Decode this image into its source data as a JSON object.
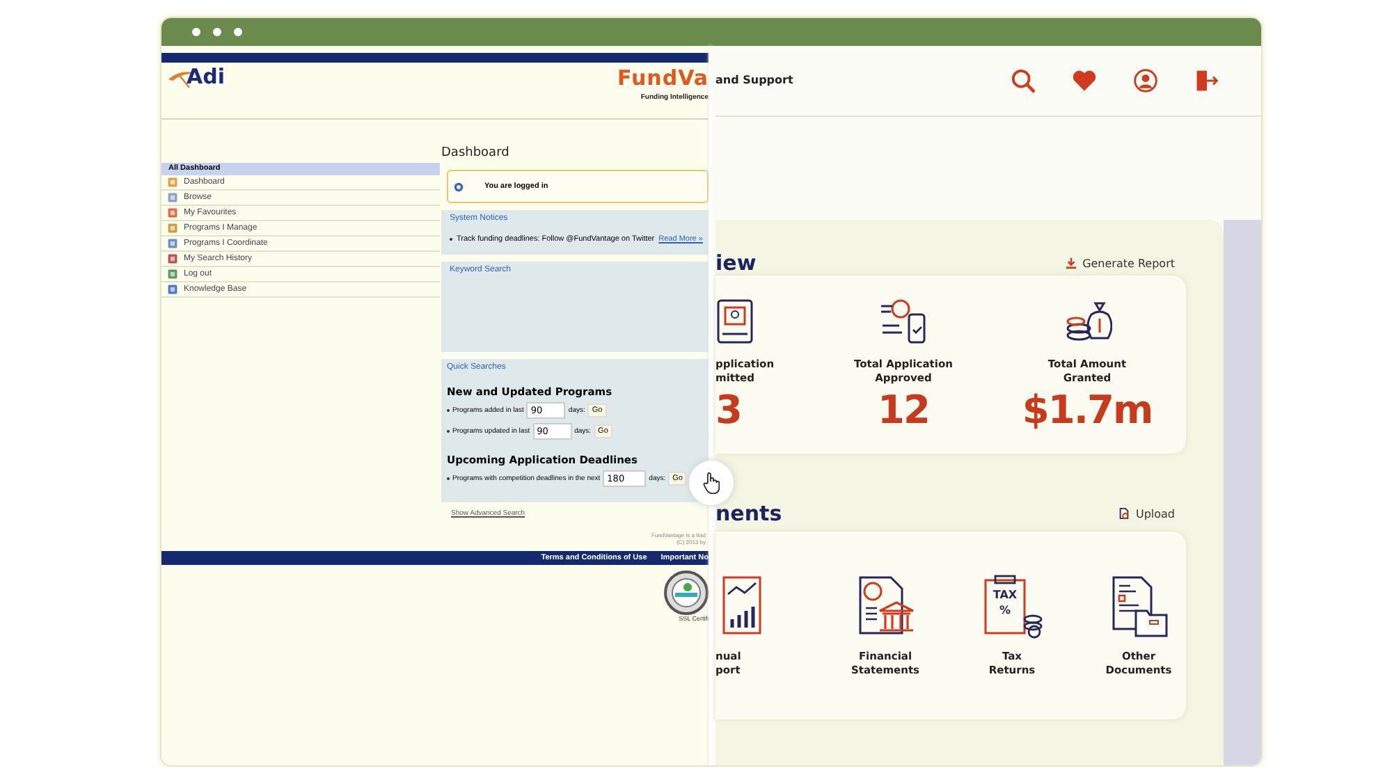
{
  "old_site": {
    "logo_left": "Adi",
    "logo_right": "FundVa",
    "tagline": "Funding Intelligence",
    "sidebar": {
      "header": "All Dashboard",
      "items": [
        {
          "label": "Dashboard"
        },
        {
          "label": "Browse"
        },
        {
          "label": "My Favourites"
        },
        {
          "label": "Programs I Manage"
        },
        {
          "label": "Programs I Coordinate"
        },
        {
          "label": "My Search History"
        },
        {
          "label": "Log out"
        },
        {
          "label": "Knowledge Base"
        }
      ]
    },
    "main": {
      "title": "Dashboard",
      "login_message": "You are logged in",
      "notices": {
        "title": "System Notices",
        "text": "Track funding deadlines: Follow @FundVantage on Twitter",
        "link": "Read More »"
      },
      "keyword_search": {
        "title": "Keyword Search"
      },
      "quick_searches": {
        "title": "Quick Searches",
        "groups": [
          {
            "heading": "New and Updated Programs",
            "rows": [
              {
                "before": "Programs added in last",
                "value": "90",
                "after": "days:",
                "button": "Go"
              },
              {
                "before": "Programs updated in last",
                "value": "90",
                "after": "days:",
                "button": "Go"
              }
            ]
          },
          {
            "heading": "Upcoming Application Deadlines",
            "rows": [
              {
                "before": "Programs with competition deadlines in the next",
                "value": "180",
                "after": "days:",
                "button": "Go"
              }
            ]
          }
        ]
      },
      "advanced_link": "Show Advanced Search"
    },
    "footer": {
      "lines": [
        "FundVantage is a trad",
        "(C) 2013 by"
      ],
      "links": [
        "Terms and Conditions of Use",
        "Important No"
      ],
      "seal_caption": "SSL Certifi"
    }
  },
  "new_site": {
    "nav_text": "and Support",
    "overview": {
      "heading": "iew",
      "action": "Generate Report",
      "stats": [
        {
          "label_lines": [
            "pplication",
            "mitted"
          ],
          "value": "3"
        },
        {
          "label_lines": [
            "Total Application",
            "Approved"
          ],
          "value": "12"
        },
        {
          "label_lines": [
            "Total Amount",
            "Granted"
          ],
          "value": "$1.7m"
        }
      ]
    },
    "documents": {
      "heading": "nents",
      "action": "Upload",
      "items": [
        {
          "kind": "report",
          "label_lines": [
            "nual",
            "port"
          ]
        },
        {
          "kind": "bank",
          "label_lines": [
            "Financial",
            "Statements"
          ]
        },
        {
          "kind": "tax",
          "label_lines": [
            "Tax",
            "Returns"
          ],
          "icon_lines": [
            "TAX",
            "%"
          ]
        },
        {
          "kind": "folder",
          "label_lines": [
            "Other",
            "Documents"
          ]
        }
      ]
    }
  }
}
